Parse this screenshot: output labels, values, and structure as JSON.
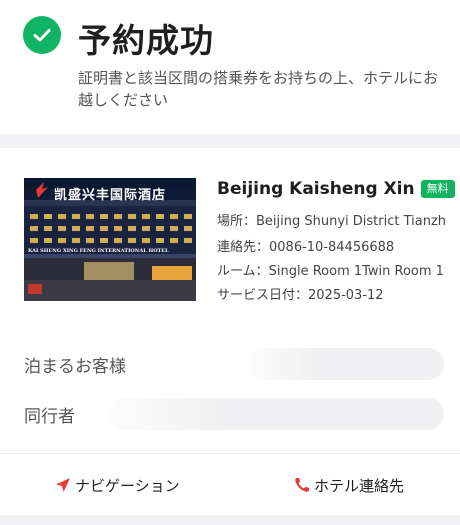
{
  "header": {
    "title": "予約成功",
    "subtitle": "証明書と該当区間の搭乗券をお持ちの上、ホテルにお越しください",
    "status_icon": "check-circle-icon",
    "accent_color": "#11b364"
  },
  "hotel": {
    "name": "Beijing Kaisheng Xin",
    "badge": "無料",
    "badge_color": "#12b35f",
    "address": "場所：Beijing Shunyi District Tianzh",
    "phone": "連絡先：0086-10-84456688",
    "room": "ルーム：Single Room 1Twin Room 1",
    "service_date": "サービス日付：2025-03-12",
    "photo_sign": "凯盛兴丰国际酒店",
    "photo_sign_en": "KAI SHENG XING FENG INTERNATIONAL HOTEL"
  },
  "guests": {
    "staying_label": "泊まるお客様",
    "companion_label": "同行者"
  },
  "footer": {
    "navigation_label": "ナビゲーション",
    "navigation_icon": "navigation-arrow-icon",
    "contact_label": "ホテル連絡先",
    "contact_icon": "phone-icon",
    "icon_color": "#e53935"
  }
}
